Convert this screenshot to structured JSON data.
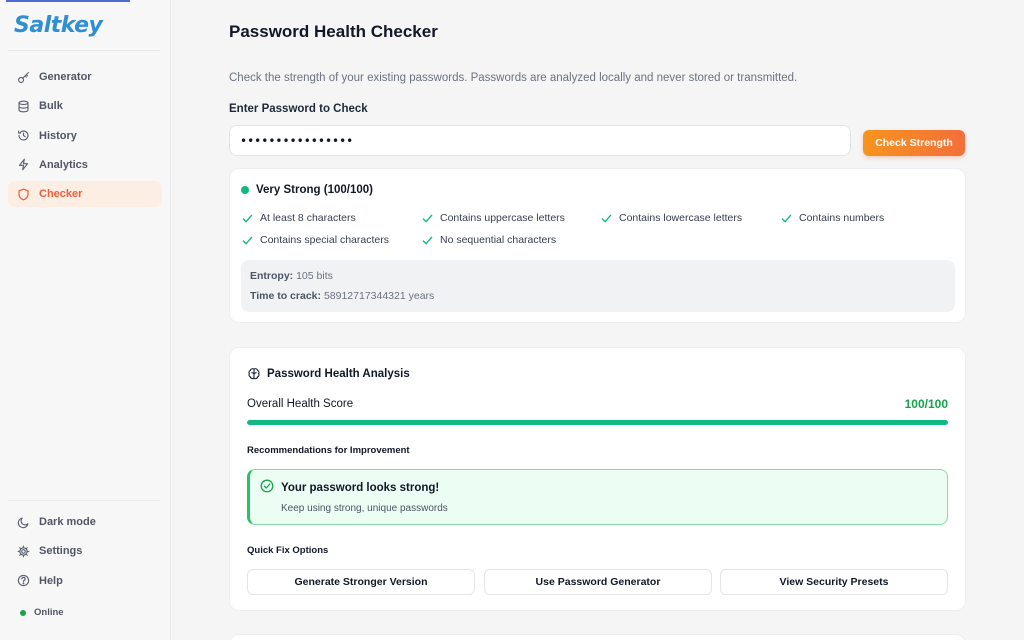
{
  "app": {
    "logo": "Saltkey"
  },
  "sidebar": {
    "items": [
      {
        "label": "Generator",
        "icon": "key-icon"
      },
      {
        "label": "Bulk",
        "icon": "database-icon"
      },
      {
        "label": "History",
        "icon": "history-icon"
      },
      {
        "label": "Analytics",
        "icon": "lightning-icon"
      },
      {
        "label": "Checker",
        "icon": "shield-icon",
        "active": true
      }
    ],
    "bottom": [
      {
        "label": "Dark mode",
        "icon": "moon-icon"
      },
      {
        "label": "Settings",
        "icon": "gear-icon"
      },
      {
        "label": "Help",
        "icon": "help-icon"
      }
    ],
    "status": "Online"
  },
  "page": {
    "title": "Password Health Checker",
    "description": "Check the strength of your existing passwords. Passwords are analyzed locally and never stored or transmitted.",
    "input_label": "Enter Password to Check",
    "input_value": "••••••••••••••••",
    "check_button": "Check Strength"
  },
  "strength": {
    "label": "Very Strong (100/100)",
    "criteria": [
      "At least 8 characters",
      "Contains uppercase letters",
      "Contains lowercase letters",
      "Contains numbers",
      "Contains special characters",
      "No sequential characters"
    ],
    "entropy_label": "Entropy:",
    "entropy_value": "105 bits",
    "crack_label": "Time to crack:",
    "crack_value": "58912717344321 years"
  },
  "health": {
    "title": "Password Health Analysis",
    "score_label": "Overall Health Score",
    "score_value": "100/100",
    "score_fraction": 1.0,
    "recommendations_label": "Recommendations for Improvement",
    "recommendation_title": "Your password looks strong!",
    "recommendation_text": "Keep using strong, unique passwords",
    "quick_fix_label": "Quick Fix Options",
    "quick_fix_buttons": [
      "Generate Stronger Version",
      "Use Password Generator",
      "View Security Presets"
    ]
  },
  "colors": {
    "accent": "#ee5d3a",
    "success": "#10b981",
    "brand": "#2f8fd2"
  }
}
